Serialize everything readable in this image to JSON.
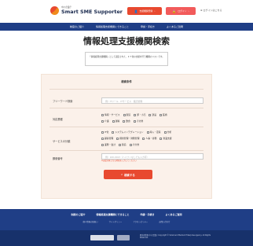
{
  "header": {
    "logo_sub": "中小企業庁",
    "logo_main": "Smart SME Supporter",
    "btn_register": "支援機関登録",
    "btn_login": "ログイン",
    "link_login": "ログインはこちら"
  },
  "nav": [
    "制度のご紹介",
    "情報処理支援機関にできること",
    "申請・手続き",
    "よくあるご質問"
  ],
  "page_title": "情報処理支援機関検索",
  "note": "「情報処理支援機関」として認定された、ＩＴ化の支援を行う機関のリストです。",
  "panel": {
    "title": "検索条件",
    "keyword_label": "フリーワード検索",
    "keyword_placeholder": "例）ITツール　ITサービス　販売管理",
    "industry_label": "対応業種",
    "industry_row1": [
      "情報・サービス",
      "製造",
      "卸・小売",
      "建設",
      "医療"
    ],
    "industry_row2": [
      "介護",
      "運輸",
      "飲食",
      "その他"
    ],
    "service_label": "サービスの分類",
    "service_row1": [
      "IT化",
      "システムインテグレーション",
      "導入・定着",
      "分析"
    ],
    "service_row2": [
      "顧客管理",
      "経営管理・財務管理",
      "人事・労務",
      "営業支援"
    ],
    "service_row3": [
      "業務・会計",
      "製造",
      "その他"
    ],
    "area_label": "郵便番号",
    "area_placeholder": "例）100-0013（ハイフンなしでも入力可）",
    "hint": "※支援対象となる地域を入力してください",
    "search_button": "検索する"
  },
  "footer": {
    "row1": [
      "制度のご紹介",
      "情報処理支援機関にできること",
      "申請・手続き",
      "よくあるご質問"
    ],
    "row2": [
      "個人情報の取扱い",
      "サイトポリシー",
      "アクセシビリティ",
      "お問い合わせ"
    ],
    "copyright": "経済産業省 中小企業庁 Copyright © Small and Medium Enterprise Agency. All Rights Reserved."
  }
}
